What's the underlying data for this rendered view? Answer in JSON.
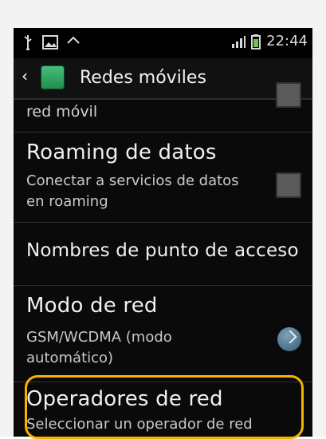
{
  "status": {
    "time": "22:44",
    "icons_left": [
      "usb-icon",
      "image-icon",
      "sync-icon"
    ],
    "icons_right": [
      "signal-icon",
      "battery-icon"
    ]
  },
  "header": {
    "title": "Redes móviles"
  },
  "settings": {
    "items": [
      {
        "sub": "red móvil"
      },
      {
        "title": "Roaming de datos",
        "sub1": "Conectar a servicios de datos",
        "sub2": "en roaming"
      },
      {
        "title": "Nombres de punto de acceso"
      },
      {
        "title": "Modo de red",
        "sub1": "GSM/WCDMA (modo",
        "sub2": "automático)"
      },
      {
        "title": "Operadores de red",
        "sub": "Seleccionar un operador de red"
      }
    ]
  },
  "colors": {
    "highlight": "#f4b400",
    "background": "#0a0a0a"
  }
}
